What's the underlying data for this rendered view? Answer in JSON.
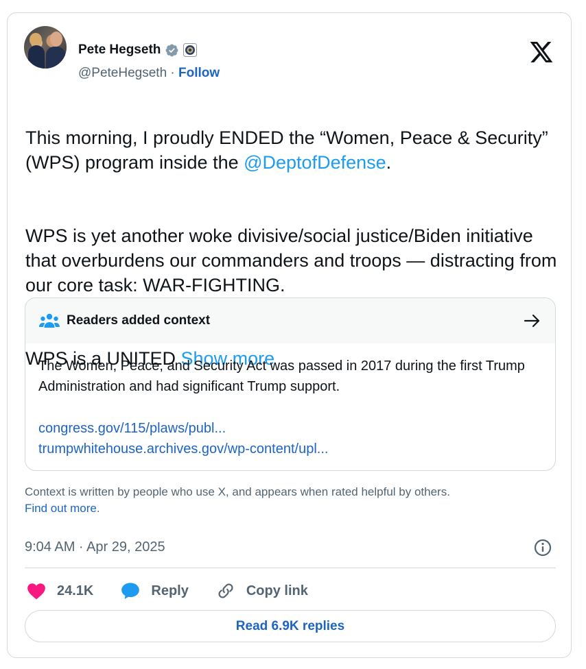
{
  "author": {
    "name": "Pete Hegseth",
    "handle": "@PeteHegseth",
    "separator": "·",
    "follow_label": "Follow",
    "verified_icon": "verified-badge-icon",
    "affiliation_icon": "department-seal-icon"
  },
  "tweet": {
    "paragraph1_part1": "This morning, I proudly ENDED the “Women, Peace & Security” (WPS) program inside the ",
    "paragraph1_mention": "@DeptofDefense",
    "paragraph1_end": ".",
    "paragraph2": "WPS is yet another woke divisive/social justice/Biden initiative that overburdens our commanders and troops — distracting from our core task: WAR-FIGHTING.",
    "paragraph3_text": "WPS is a UNITED ",
    "show_more": "Show more"
  },
  "community_note": {
    "title": "Readers added context",
    "body": "The Women, Peace, and Security Act was passed in 2017 during the first Trump Administration and had significant Trump support.",
    "links": [
      "congress.gov/115/plaws/publ...",
      "trumpwhitehouse.archives.gov/wp-content/upl..."
    ]
  },
  "disclaimer": {
    "text": "Context is written by people who use X, and appears when rated helpful by others.",
    "link": "Find out more",
    "end": "."
  },
  "timestamp": "9:04 AM · Apr 29, 2025",
  "actions": {
    "likes": "24.1K",
    "reply": "Reply",
    "copy_link": "Copy link"
  },
  "read_replies": "Read 6.9K replies",
  "colors": {
    "link": "#1d9bf0",
    "heart": "#f91880",
    "border": "#cfd9de",
    "muted": "#536471"
  }
}
